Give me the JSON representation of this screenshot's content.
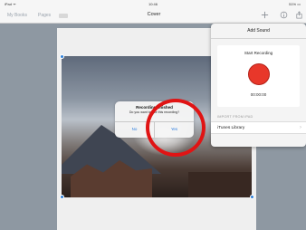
{
  "status_bar": {
    "carrier": "iPad ᯤ",
    "time": "10:46",
    "battery": "51% ▭"
  },
  "nav": {
    "back_label": "My Books",
    "pages_label": "Pages",
    "title": "Cover",
    "icons": [
      "plus-icon",
      "info-icon",
      "share-icon"
    ]
  },
  "alert": {
    "title": "Recording finished",
    "message": "Do you want to use this recording?",
    "no_label": "No",
    "yes_label": "Yes"
  },
  "popover": {
    "title": "Add Sound",
    "record_label": "Start Recording",
    "timer": "00:00:00",
    "section_label": "IMPORT FROM iPAD",
    "itunes_label": "iTunes Library"
  },
  "colors": {
    "accent": "#2f7fe0",
    "record": "#e8372a",
    "highlight_circle": "#e01414"
  }
}
